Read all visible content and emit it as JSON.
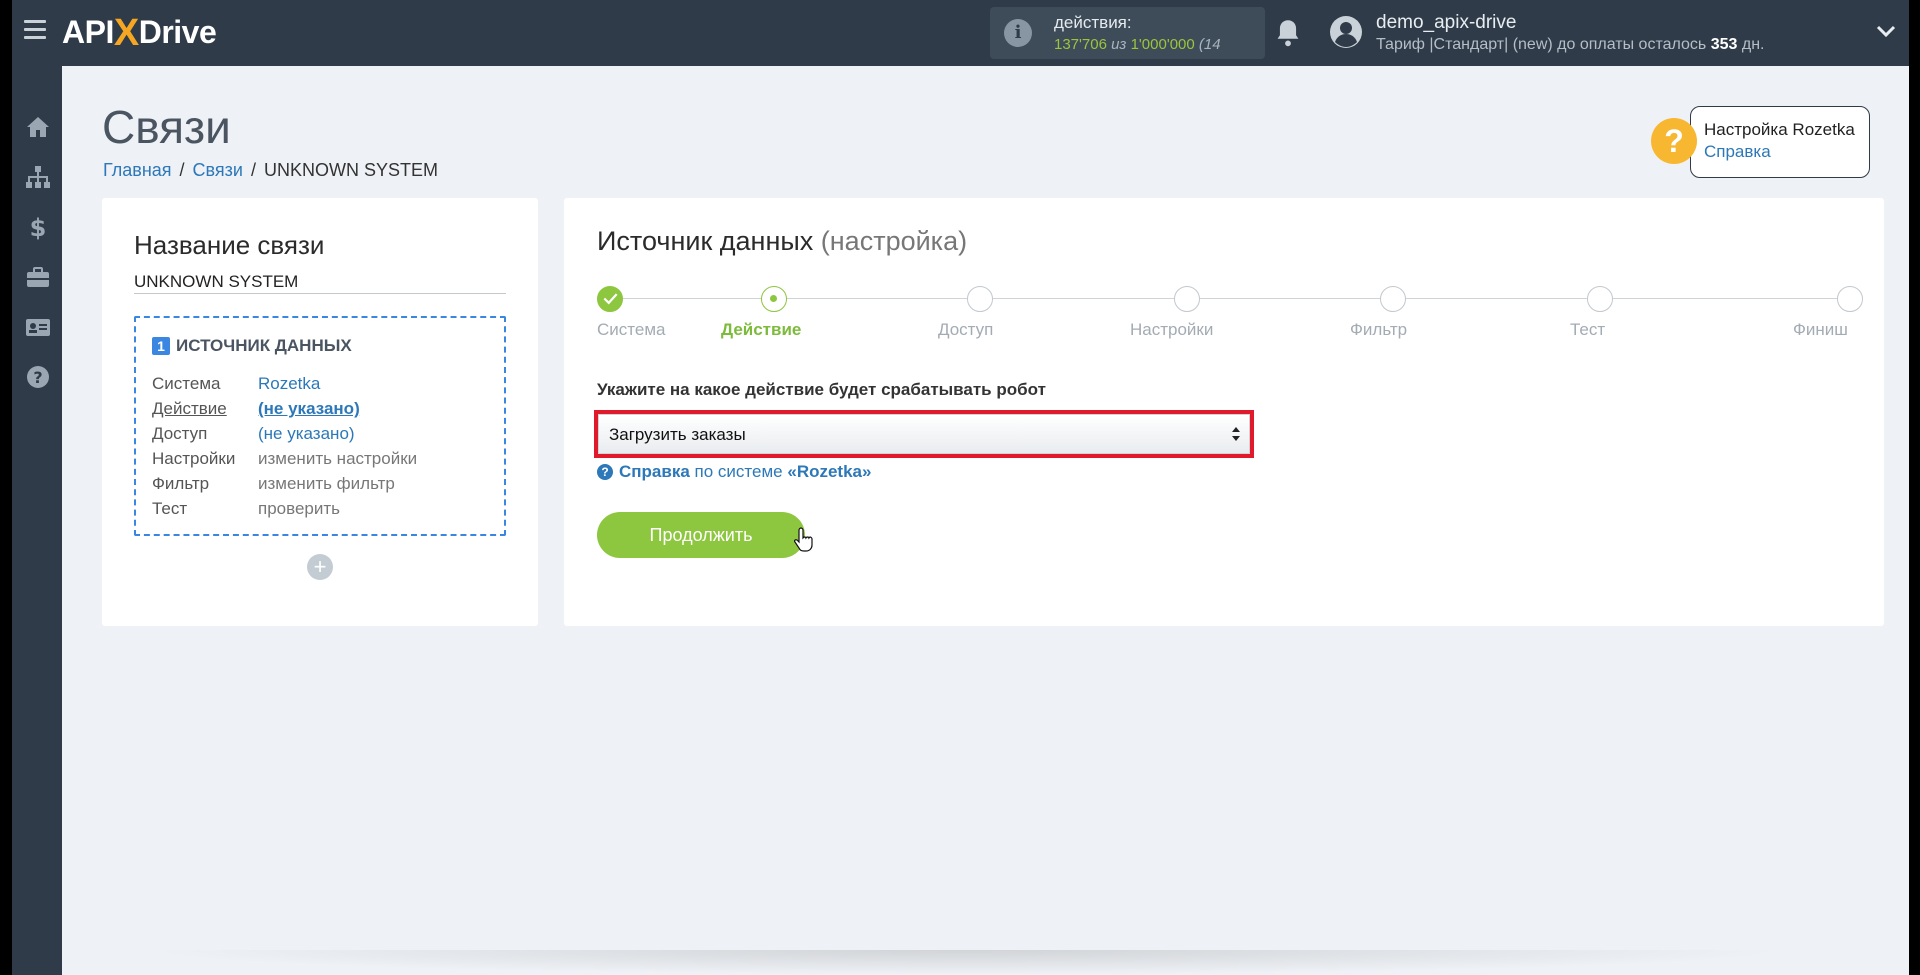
{
  "header": {
    "logo_part1": "API",
    "logo_x": "X",
    "logo_part2": "Drive",
    "actions_label": "действия:",
    "actions_used": "137'706",
    "actions_of": "из",
    "actions_total": "1'000'000",
    "actions_extra": "(14",
    "user_name": "demo_apix-drive",
    "tariff_text": "Тариф |Стандарт| (new) до оплаты осталось",
    "tariff_days": "353",
    "tariff_unit": "дн."
  },
  "sidebar": {
    "items": [
      "home-icon",
      "sitemap-icon",
      "dollar-icon",
      "briefcase-icon",
      "id-card-icon",
      "help-icon"
    ]
  },
  "page": {
    "title": "Связи",
    "breadcrumb": [
      "Главная",
      "Связи",
      "UNKNOWN SYSTEM"
    ],
    "help_title": "Настройка Rozetka",
    "help_link": "Справка"
  },
  "left_panel": {
    "title": "Название связи",
    "connection_name": "UNKNOWN SYSTEM",
    "source_number": "1",
    "source_title": "ИСТОЧНИК ДАННЫХ",
    "rows": [
      {
        "key": "Система",
        "value": "Rozetka"
      },
      {
        "key": "Действие",
        "value": "(не указано)"
      },
      {
        "key": "Доступ",
        "value": "(не указано)"
      },
      {
        "key": "Настройки",
        "value": "изменить настройки"
      },
      {
        "key": "Фильтр",
        "value": "изменить фильтр"
      },
      {
        "key": "Тест",
        "value": "проверить"
      }
    ],
    "add_label": "+"
  },
  "right_panel": {
    "title": "Источник данных",
    "title_suffix": "(настройка)",
    "steps": [
      {
        "label": "Система",
        "state": "done"
      },
      {
        "label": "Действие",
        "state": "active"
      },
      {
        "label": "Доступ",
        "state": "todo"
      },
      {
        "label": "Настройки",
        "state": "todo"
      },
      {
        "label": "Фильтр",
        "state": "todo"
      },
      {
        "label": "Тест",
        "state": "todo"
      },
      {
        "label": "Финиш",
        "state": "todo"
      }
    ],
    "question": "Укажите на какое действие будет срабатывать робот",
    "selected_action": "Загрузить заказы",
    "help_prefix": "Справка",
    "help_middle": "по системе",
    "help_system": "«Rozetka»",
    "continue_label": "Продолжить"
  },
  "colors": {
    "topbar": "#2f3b48",
    "accent_green": "#8dc63f",
    "link_blue": "#2c78b8",
    "highlight_red": "#e0192b",
    "help_yellow": "#f7b731"
  }
}
